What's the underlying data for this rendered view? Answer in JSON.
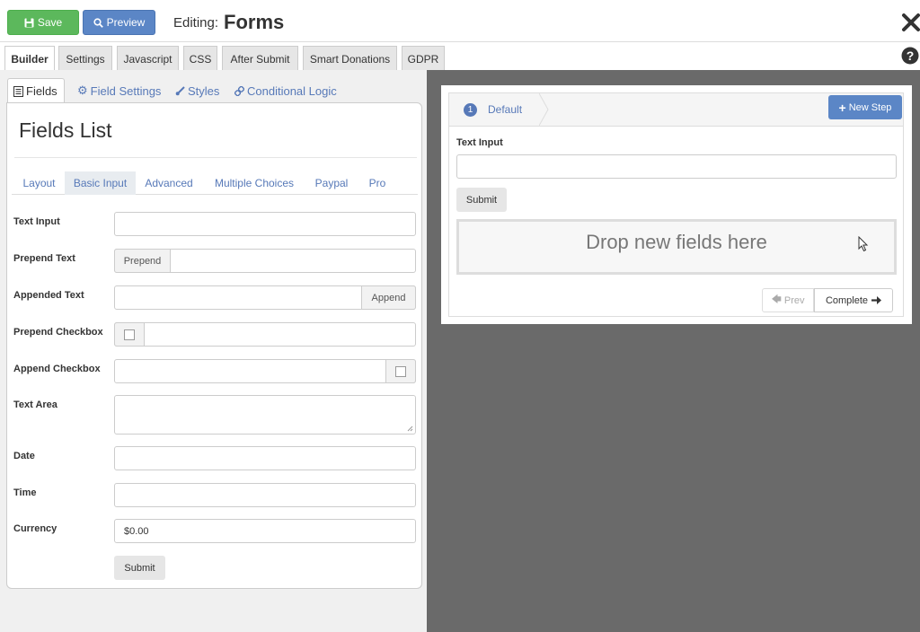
{
  "toolbar": {
    "save_label": "Save",
    "preview_label": "Preview",
    "editing_label": "Editing:",
    "form_name": "Forms"
  },
  "top_tabs": [
    "Builder",
    "Settings",
    "Javascript",
    "CSS",
    "After Submit",
    "Smart Donations",
    "GDPR"
  ],
  "sub_tabs": [
    "Fields",
    "Field Settings",
    "Styles",
    "Conditional Logic"
  ],
  "fields_panel": {
    "title": "Fields List",
    "categories": [
      "Layout",
      "Basic Input",
      "Advanced",
      "Multiple Choices",
      "Paypal",
      "Pro"
    ],
    "rows": {
      "text_input": "Text Input",
      "prepend_text": "Prepend Text",
      "prepend_addon": "Prepend",
      "appended_text": "Appended Text",
      "append_addon": "Append",
      "prepend_checkbox": "Prepend Checkbox",
      "append_checkbox": "Append Checkbox",
      "text_area": "Text Area",
      "date": "Date",
      "time": "Time",
      "currency": "Currency",
      "currency_value": "$0.00"
    },
    "submit_label": "Submit"
  },
  "preview": {
    "step_number": "1",
    "step_name": "Default",
    "new_step_label": "New Step",
    "field_label": "Text Input",
    "submit_label": "Submit",
    "dropzone_text": "Drop new fields here",
    "prev_label": "Prev",
    "complete_label": "Complete"
  },
  "colors": {
    "save": "#5cb85c",
    "primary": "#5b86c6",
    "link": "#5779b8",
    "canvas": "#6a6a6a"
  }
}
